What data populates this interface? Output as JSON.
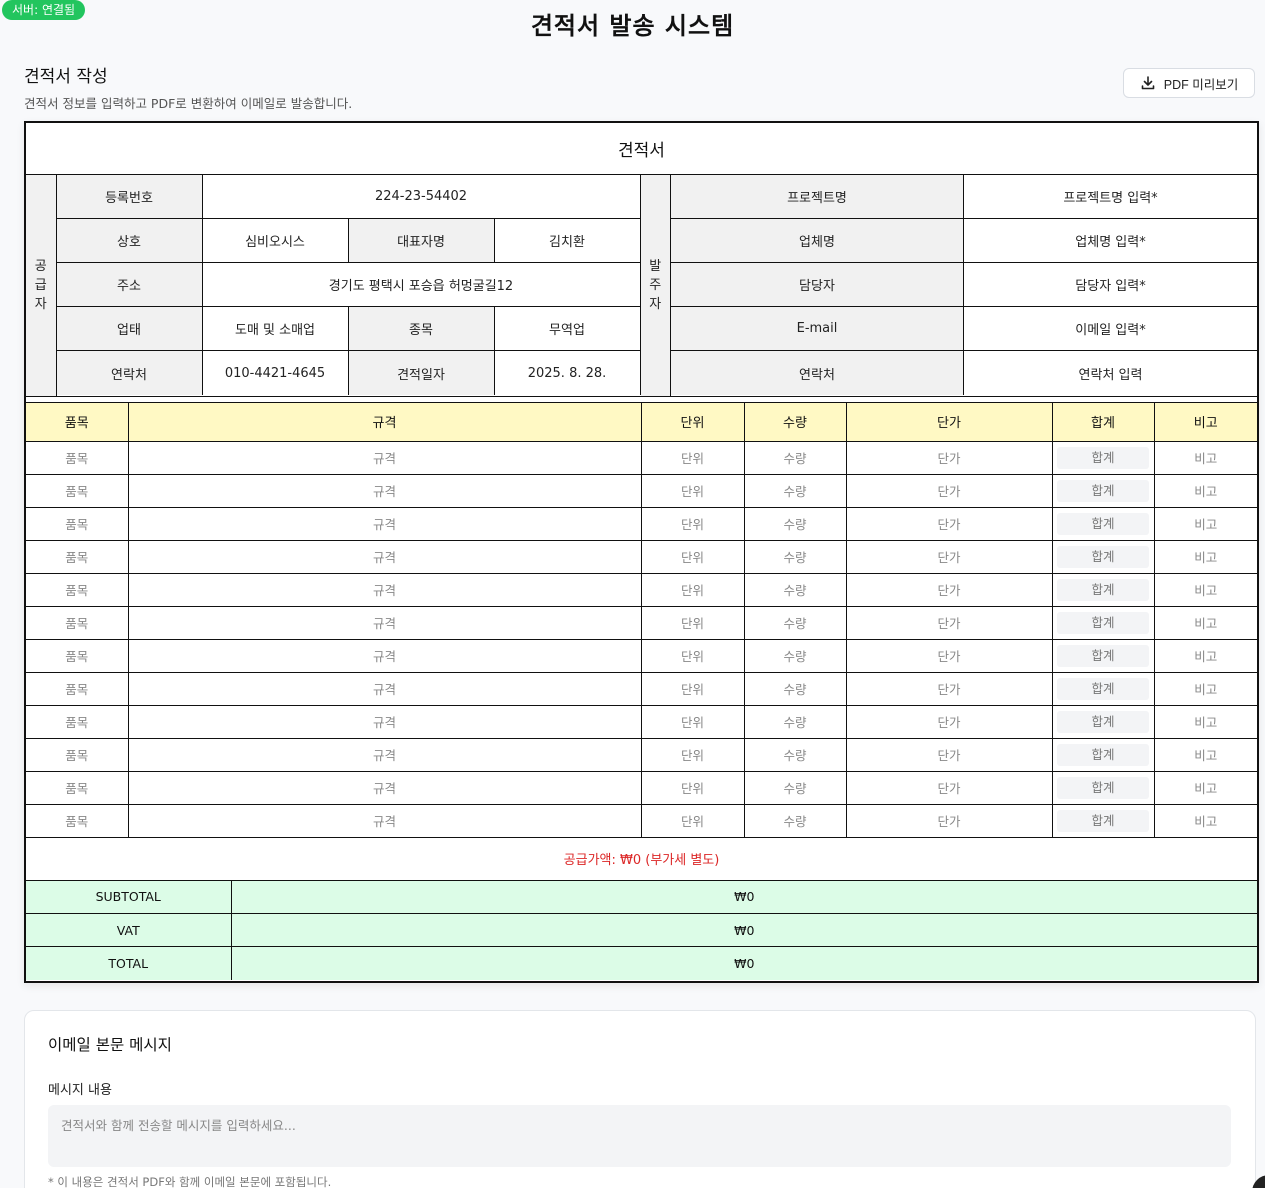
{
  "server_status": "서버: 연결됨",
  "app_title": "견적서 발송 시스템",
  "section": {
    "title": "견적서 작성",
    "subtitle": "견적서 정보를 입력하고 PDF로 변환하여 이메일로 발송합니다.",
    "pdf_preview_label": "PDF 미리보기"
  },
  "quote": {
    "title": "견적서",
    "supplier_label": "공급자",
    "client_label": "발주자",
    "supplier": {
      "reg_no_label": "등록번호",
      "reg_no": "224-23-54402",
      "company_label": "상호",
      "company": "심비오시스",
      "ceo_label": "대표자명",
      "ceo": "김치환",
      "address_label": "주소",
      "address": "경기도 평택시 포승읍 허멍굴길12",
      "business_type_label": "업태",
      "business_type": "도매 및 소매업",
      "business_item_label": "종목",
      "business_item": "무역업",
      "contact_label": "연락처",
      "contact": "010-4421-4645",
      "date_label": "견적일자",
      "date": "2025. 8. 28."
    },
    "client": {
      "project_label": "프로젝트명",
      "project_placeholder": "프로젝트명 입력*",
      "company_label": "업체명",
      "company_placeholder": "업체명 입력*",
      "manager_label": "담당자",
      "manager_placeholder": "담당자 입력*",
      "email_label": "E-mail",
      "email_placeholder": "이메일 입력*",
      "contact_label": "연락처",
      "contact_placeholder": "연락처 입력"
    },
    "columns": [
      "품목",
      "규격",
      "단위",
      "수량",
      "단가",
      "합계",
      "비고"
    ],
    "row_placeholders": [
      "품목",
      "규격",
      "단위",
      "수량",
      "단가",
      "합계",
      "비고"
    ],
    "row_count": 12,
    "supply_amount": "공급가액: ₩0 (부가세 별도)",
    "totals": [
      {
        "label": "SUBTOTAL",
        "value": "₩0"
      },
      {
        "label": "VAT",
        "value": "₩0"
      },
      {
        "label": "TOTAL",
        "value": "₩0"
      }
    ]
  },
  "email": {
    "title": "이메일 본문 메시지",
    "message_label": "메시지 내용",
    "message_placeholder": "견적서와 함께 전송할 메시지를 입력하세요...",
    "note": "* 이 내용은 견적서 PDF와 함께 이메일 본문에 포함됩니다."
  }
}
